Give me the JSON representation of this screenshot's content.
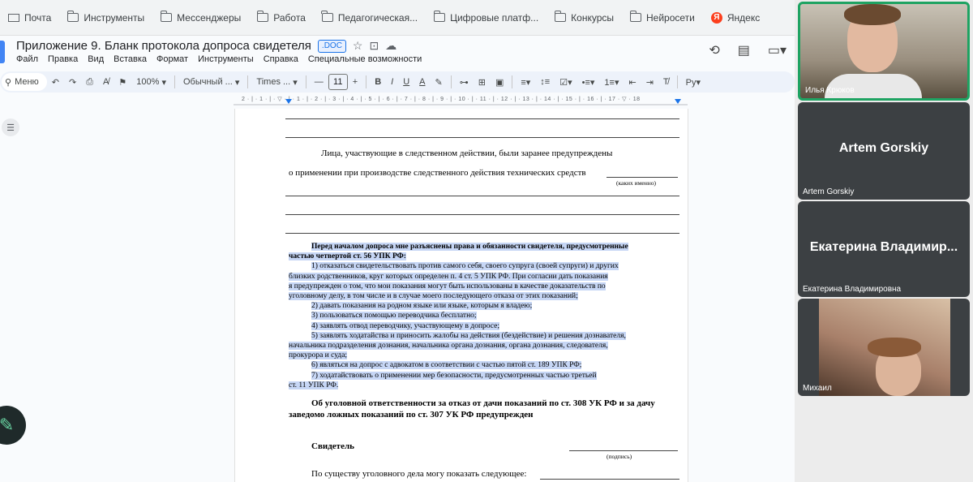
{
  "bookmarks": [
    {
      "label": "Почта",
      "icon": "mail-icon"
    },
    {
      "label": "Инструменты",
      "icon": "folder-icon"
    },
    {
      "label": "Мессенджеры",
      "icon": "folder-icon"
    },
    {
      "label": "Работа",
      "icon": "folder-icon"
    },
    {
      "label": "Педагогическая...",
      "icon": "folder-icon"
    },
    {
      "label": "Цифровые платф...",
      "icon": "folder-icon"
    },
    {
      "label": "Конкурсы",
      "icon": "folder-icon"
    },
    {
      "label": "Нейросети",
      "icon": "folder-icon"
    },
    {
      "label": "Яндекс",
      "icon": "yandex-icon"
    }
  ],
  "doc": {
    "title": "Приложение 9. Бланк протокола допроса свидетеля",
    "badge": ".DOC",
    "menu": [
      "Файл",
      "Правка",
      "Вид",
      "Вставка",
      "Формат",
      "Инструменты",
      "Справка",
      "Специальные возможности"
    ]
  },
  "toolbar": {
    "menu_label": "Меню",
    "zoom": "100%",
    "style": "Обычный ...",
    "font": "Times ...",
    "font_size": "11"
  },
  "ruler": {
    "marks": "2 · | · 1 · | · ▽ · | · 1 · | · 2 · | · 3 · | · 4 · | · 5 · | · 6 · | · 7 · | · 8 · | · 9 · | · 10 · | · 11 · | · 12 · | · 13 · | · 14 · | · 15 · | · 16 · | · 17 · ▽ · 18"
  },
  "page": {
    "para1_line1": "Лица,   участвующие   в   следственном   действии,  были  заранее  предупреждены",
    "para1_line2": "о применении при производстве следственного действия технических средств",
    "caption1": "(каких именно)",
    "selected": [
      "Перед началом допроса мне разъяснены права и обязанности свидетеля, предусмотренные",
      "частью четвертой ст. 56 УПК РФ:",
      "1) отказаться свидетельствовать против самого себя, своего супруга (своей супруги) и других",
      "близких родственников, круг которых определен п. 4 ст. 5 УПК РФ. При согласии дать показания",
      "я предупрежден о том, что мои показания могут быть использованы в качестве доказательств по",
      "уголовному делу, в том числе и в случае моего последующего отказа от этих показаний;",
      "2) давать показания на родном языке или языке, которым я владею;",
      "3) пользоваться помощью переводчика бесплатно;",
      "4) заявлять отвод переводчику, участвующему в допросе;",
      "5) заявлять ходатайства и приносить жалобы на действия (бездействие) и решения дознавателя,",
      "начальника подразделения дознания, начальника органа дознания, органа дознания, следователя,",
      "прокурора и суда;",
      "6) являться на допрос с адвокатом в соответствии с частью пятой ст. 189 УПК РФ;",
      "7) ходатайствовать о применении мер безопасности, предусмотренных частью третьей",
      "ст. 11 УПК РФ."
    ],
    "warning_line1": "Об уголовной ответственности за отказ от дачи показаний по ст. 308 УК РФ и за дачу",
    "warning_line2": "заведомо ложных показаний по ст. 307 УК РФ предупрежден",
    "witness_label": "Свидетель",
    "caption2": "(подпись)",
    "testimony_label": "По существу уголовного дела могу показать следующее:"
  },
  "participants": [
    {
      "name": "Илья Крюков",
      "video": true
    },
    {
      "name": "Artem Gorskiy",
      "display": "Artem Gorskiy",
      "video": false
    },
    {
      "name": "Екатерина Владимировна",
      "display": "Екатерина Владимир...",
      "video": false
    },
    {
      "name": "Михаил",
      "video": true
    }
  ],
  "colors": {
    "accent": "#1a73e8",
    "selection": "#c6d6f5",
    "active_speaker": "#1ea362"
  }
}
